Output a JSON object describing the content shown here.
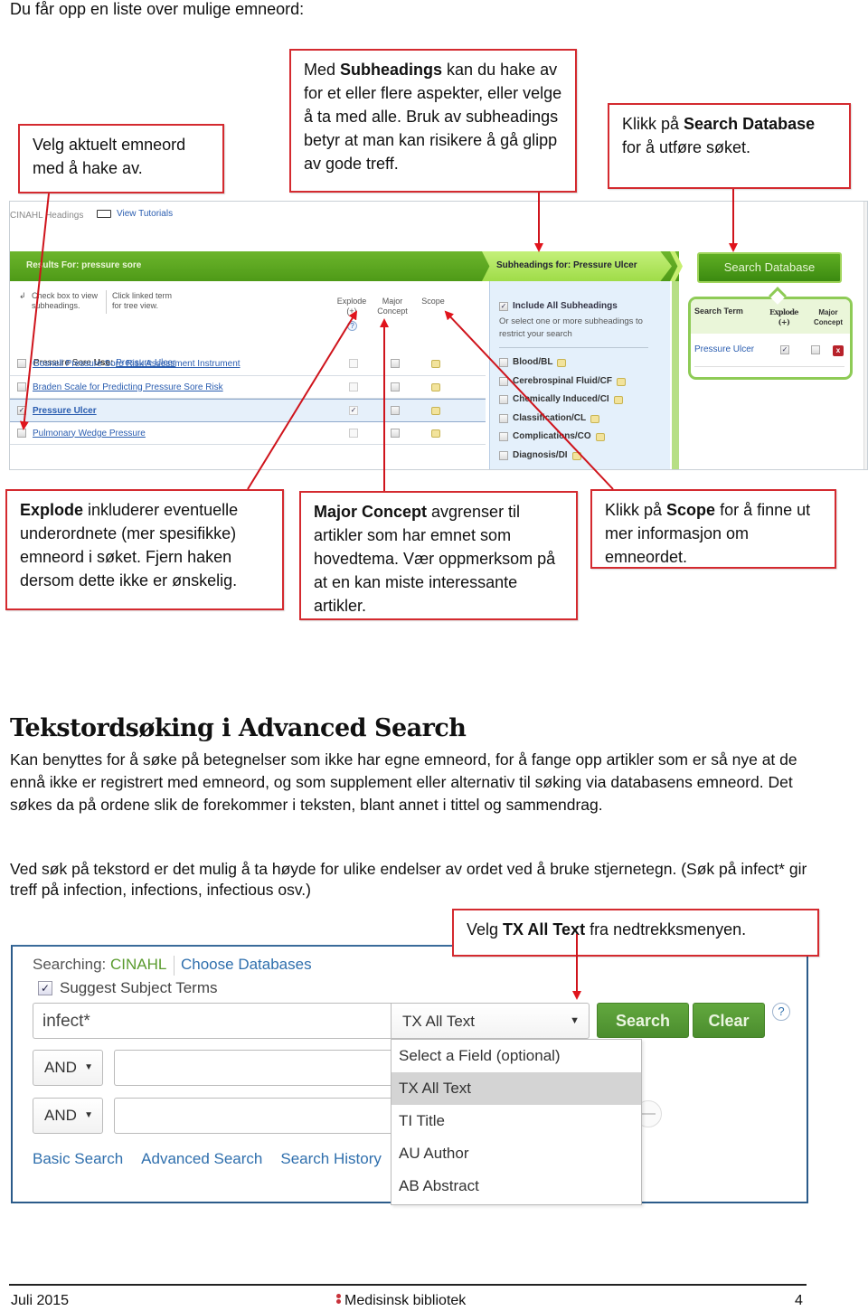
{
  "intro": "Du får opp en liste over mulige emneord:",
  "callouts": {
    "select_term": {
      "text": "Velg aktuelt emneord med å hake av."
    },
    "subheadings": {
      "pre": "Med ",
      "bold": "Subheadings",
      "post": " kan du hake av for et eller flere aspekter, eller velge å ta med alle.  Bruk av subheadings betyr at man kan risikere å gå glipp av gode treff."
    },
    "search_db": {
      "pre": "Klikk på ",
      "bold": "Search Database",
      "post": " for å utføre søket."
    },
    "explode": {
      "bold": "Explode",
      "post": " inkluderer eventuelle underordnete (mer spesifikke) emneord i søket. Fjern haken dersom dette ikke er ønskelig."
    },
    "major": {
      "bold": "Major Concept",
      "post": " avgrenser til artikler som har emnet som hovedtema. Vær oppmerksom på at en kan miste interessante artikler."
    },
    "scope": {
      "pre": "Klikk på ",
      "bold": "Scope",
      "post": " for å finne ut mer informasjon om emneordet."
    },
    "tx": {
      "pre": "Velg ",
      "bold": "TX All Text",
      "post": " fra nedtrekksmenyen."
    }
  },
  "screenshot1": {
    "breadcrumb": "CINAHL Headings",
    "view_tutorials": "View Tutorials",
    "results_bar": "Results For: pressure sore",
    "hint_check": "Check box to view subheadings.",
    "hint_click": "Click linked term for tree view.",
    "col_explode": "Explode (+)",
    "col_major": "Major Concept",
    "col_scope": "Scope",
    "use_prefix": "Pressure Sore",
    "use_label": "Use:",
    "use_link": "Pressure Ulcer",
    "terms": [
      {
        "label": "Gosnell Pressure Sore Risk Assessment Instrument",
        "checked": false,
        "explode": false,
        "selected": false
      },
      {
        "label": "Braden Scale for Predicting Pressure Sore Risk",
        "checked": false,
        "explode": false,
        "selected": false
      },
      {
        "label": "Pressure Ulcer",
        "checked": true,
        "explode": true,
        "selected": true
      },
      {
        "label": "Pulmonary Wedge Pressure",
        "checked": false,
        "explode": false,
        "selected": false
      }
    ],
    "subheadings_bar": "Subheadings for: Pressure Ulcer",
    "include_all": "Include All Subheadings",
    "include_desc": "Or select one or more subheadings to restrict your search",
    "subheadings": [
      "Blood/BL",
      "Cerebrospinal Fluid/CF",
      "Chemically Induced/CI",
      "Classification/CL",
      "Complications/CO",
      "Diagnosis/DI"
    ],
    "search_database": "Search Database",
    "term_box": {
      "col_term": "Search Term",
      "col_explode": "Explode (+)",
      "col_major": "Major Concept",
      "term": "Pressure Ulcer",
      "delete": "x"
    }
  },
  "section": {
    "heading": "Tekstordsøking i Advanced Search",
    "para1": "Kan benyttes for å søke på betegnelser som ikke har egne emneord, for å fange opp artikler som er så nye at de ennå ikke er registrert med emneord, og som supplement eller alternativ til søking via databasens emneord. Det søkes da på ordene slik de forekommer i teksten, blant annet i tittel og sammendrag.",
    "para2": "Ved søk på tekstord er det mulig å ta høyde for ulike endelser av ordet ved å bruke stjernetegn. (Søk på infect* gir treff på infection, infections, infectious osv.)"
  },
  "screenshot2": {
    "searching_label": "Searching:",
    "database": "CINAHL",
    "choose_databases": "Choose Databases",
    "suggest_terms": "Suggest Subject Terms",
    "suggest_checked": true,
    "query": "infect*",
    "field_selected": "TX All Text",
    "search_button": "Search",
    "clear_button": "Clear",
    "help": "?",
    "bool1": "AND",
    "bool2": "AND",
    "links": [
      "Basic Search",
      "Advanced Search",
      "Search History"
    ],
    "field_options": [
      "Select a Field (optional)",
      "TX All Text",
      "TI Title",
      "AU Author",
      "AB Abstract"
    ],
    "highlighted_option": "TX All Text"
  },
  "footer": {
    "date": "Juli 2015",
    "org": "Medisinsk bibliotek",
    "page": "4"
  },
  "colors": {
    "callout_border": "#d42a2f",
    "green_button": "#4b8d2e",
    "link_blue": "#2f6fad"
  }
}
